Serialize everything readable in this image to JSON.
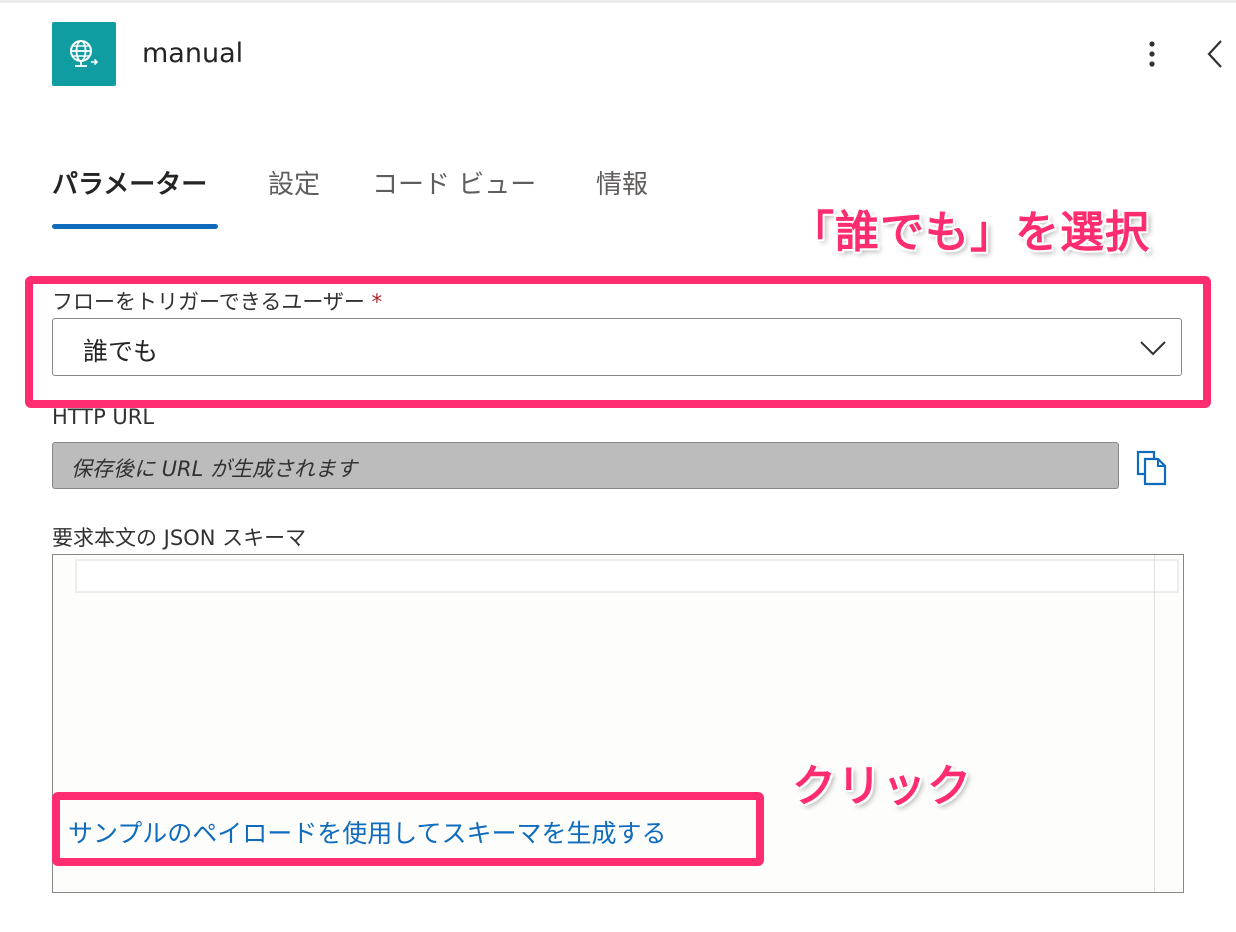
{
  "header": {
    "title": "manual",
    "icon": "http-globe-icon",
    "icon_bg": "#0f9da1"
  },
  "tabs": [
    {
      "label": "パラメーター",
      "active": true
    },
    {
      "label": "設定"
    },
    {
      "label": "コード ビュー"
    },
    {
      "label": "情報"
    }
  ],
  "form": {
    "who_can_trigger": {
      "label": "フローをトリガーできるユーザー",
      "required_mark": "*",
      "value": "誰でも"
    },
    "http_url": {
      "label": "HTTP URL",
      "value": "保存後に URL が生成されます"
    },
    "schema": {
      "label": "要求本文の JSON スキーマ",
      "generate_link": "サンプルのペイロードを使用してスキーマを生成する"
    }
  },
  "annotations": {
    "select_note": "「誰でも」を選択",
    "click_note": "クリック",
    "color": "#ff2d6f"
  },
  "accent_color": "#0f6cbd"
}
